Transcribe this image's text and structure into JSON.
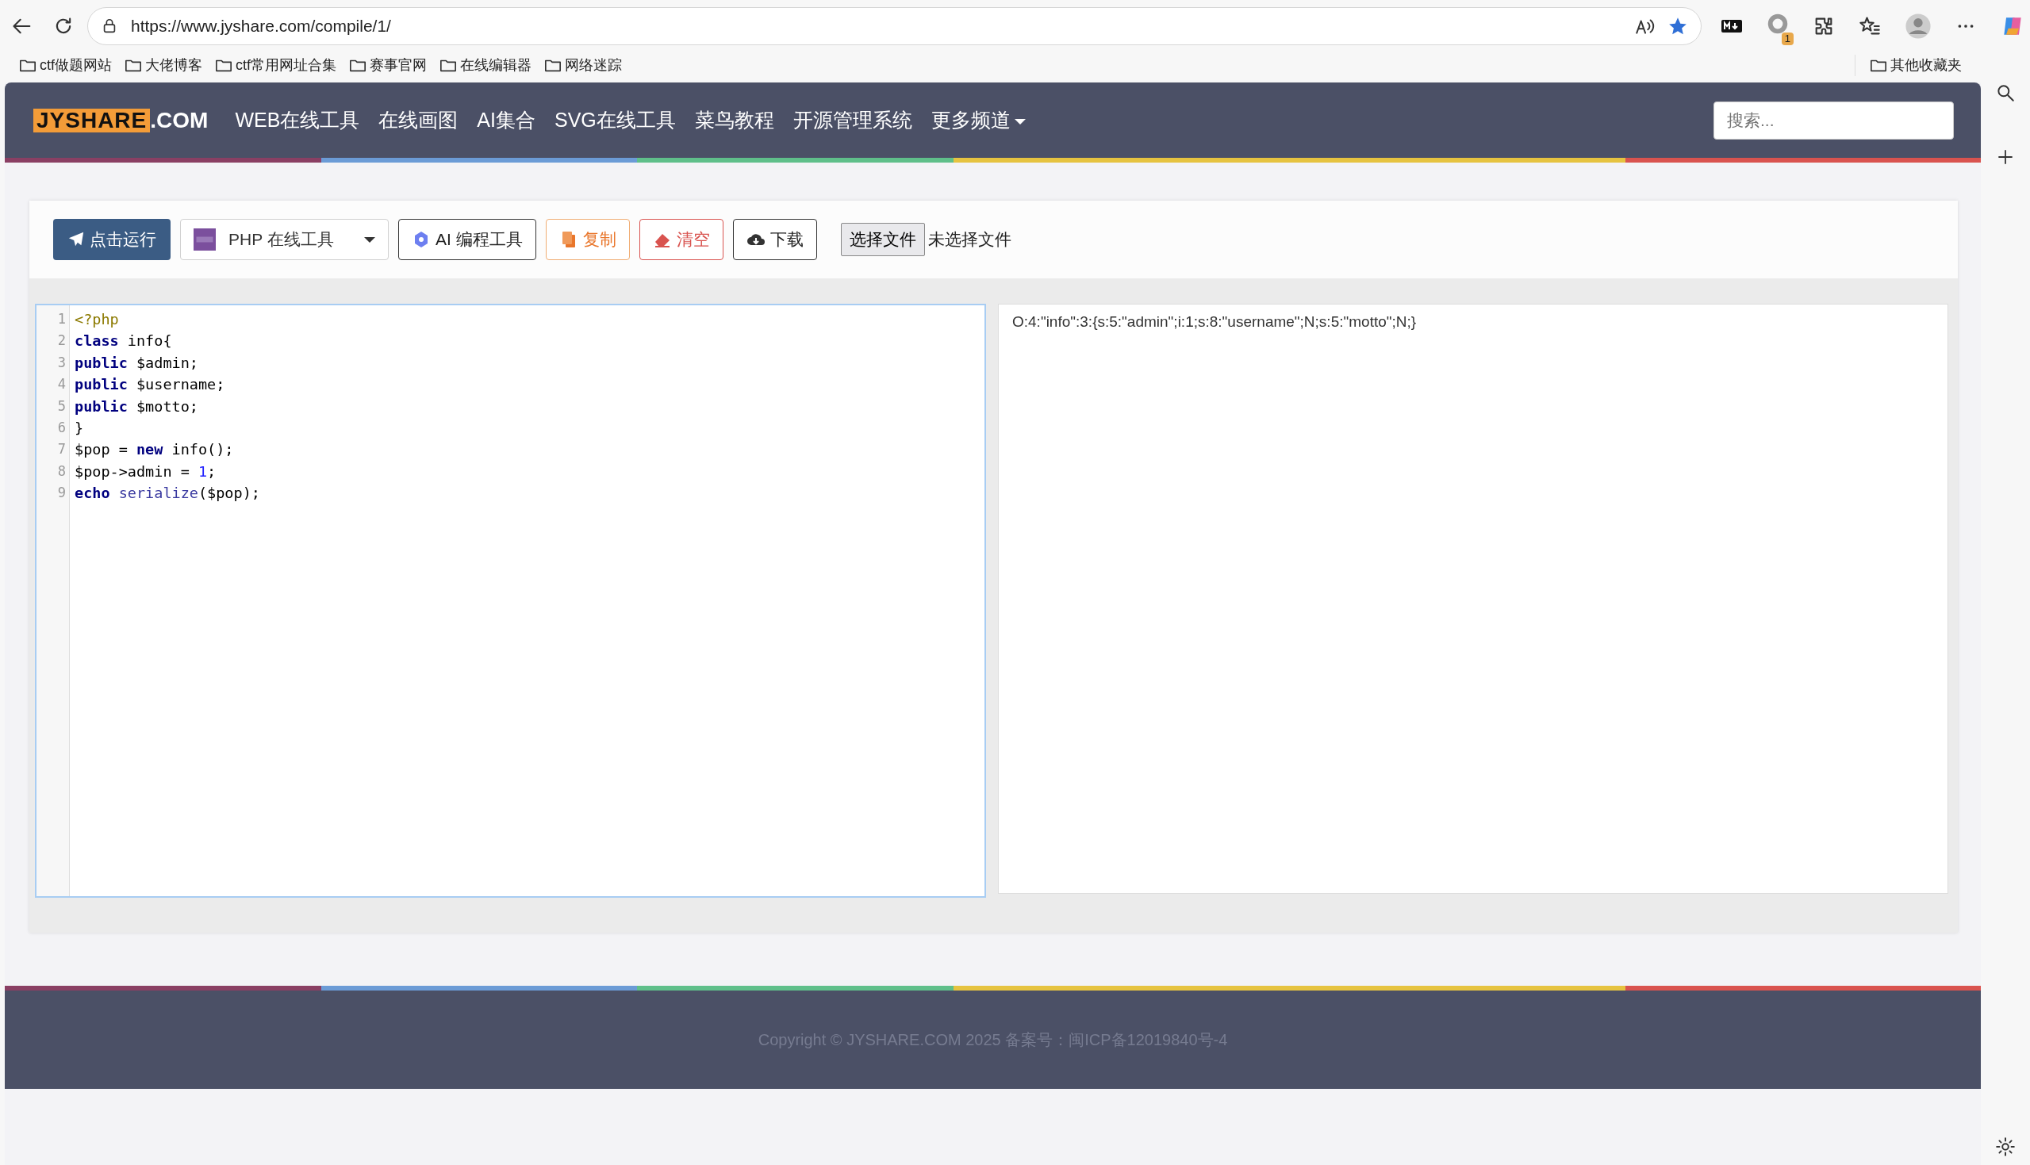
{
  "browser": {
    "url": "https://www.jyshare.com/compile/1/",
    "bookmarks": [
      "ctf做题网站",
      "大佬博客",
      "ctf常用网址合集",
      "赛事官网",
      "在线编辑器",
      "网络迷踪"
    ],
    "other_bookmarks": "其他收藏夹",
    "extension_badge": "1"
  },
  "navbar": {
    "logo_main": "JYSHARE",
    "logo_suffix": ".COM",
    "items": [
      {
        "label": "WEB在线工具",
        "dropdown": false
      },
      {
        "label": "在线画图",
        "dropdown": false
      },
      {
        "label": "AI集合",
        "dropdown": false
      },
      {
        "label": "SVG在线工具",
        "dropdown": false
      },
      {
        "label": "菜鸟教程",
        "dropdown": false
      },
      {
        "label": "开源管理系统",
        "dropdown": false
      },
      {
        "label": "更多频道",
        "dropdown": true
      }
    ],
    "search": {
      "placeholder": "搜索..."
    }
  },
  "toolbar": {
    "run_button": "点击运行",
    "language_select": "PHP 在线工具",
    "buttons": [
      {
        "kind": "ai",
        "label": "AI 编程工具"
      },
      {
        "kind": "copy",
        "label": "复制"
      },
      {
        "kind": "clear",
        "label": "清空"
      },
      {
        "kind": "download",
        "label": "下载"
      }
    ],
    "file_button": "选择文件",
    "file_status": "未选择文件"
  },
  "editor": {
    "lines": [
      {
        "number": "1",
        "tokens": [
          {
            "kind": "meta",
            "text": "<?php"
          }
        ]
      },
      {
        "number": "2",
        "tokens": [
          {
            "kind": "keyword",
            "text": "class"
          },
          {
            "kind": "plain",
            "text": " info{"
          }
        ]
      },
      {
        "number": "3",
        "tokens": [
          {
            "kind": "keyword",
            "text": "public"
          },
          {
            "kind": "plain",
            "text": " $admin;"
          }
        ]
      },
      {
        "number": "4",
        "tokens": [
          {
            "kind": "keyword",
            "text": "public"
          },
          {
            "kind": "plain",
            "text": " $username;"
          }
        ]
      },
      {
        "number": "5",
        "tokens": [
          {
            "kind": "keyword",
            "text": "public"
          },
          {
            "kind": "plain",
            "text": " $motto;"
          }
        ]
      },
      {
        "number": "6",
        "tokens": [
          {
            "kind": "plain",
            "text": "}"
          }
        ]
      },
      {
        "number": "7",
        "tokens": [
          {
            "kind": "plain",
            "text": "$pop = "
          },
          {
            "kind": "keyword",
            "text": "new"
          },
          {
            "kind": "plain",
            "text": " info();"
          }
        ]
      },
      {
        "number": "8",
        "tokens": [
          {
            "kind": "plain",
            "text": "$pop->admin = "
          },
          {
            "kind": "number",
            "text": "1"
          },
          {
            "kind": "plain",
            "text": ";"
          }
        ]
      },
      {
        "number": "9",
        "tokens": [
          {
            "kind": "keyword",
            "text": "echo"
          },
          {
            "kind": "builtin",
            "text": " serialize"
          },
          {
            "kind": "plain",
            "text": "($pop);"
          }
        ]
      }
    ]
  },
  "output": {
    "text": "O:4:\"info\":3:{s:5:\"admin\";i:1;s:8:\"username\";N;s:5:\"motto\";N;}"
  },
  "footer": {
    "copyright": "Copyright © JYSHARE.COM 2025 备案号：闽ICP备12019840号-4"
  }
}
